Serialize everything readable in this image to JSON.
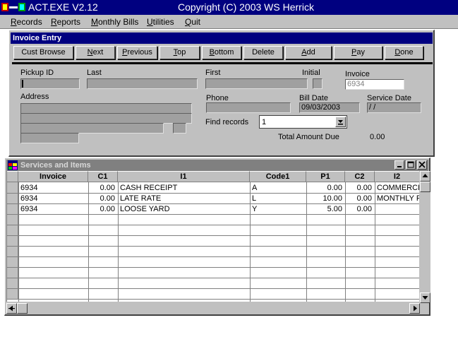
{
  "window": {
    "title": "ACT.EXE  V2.12",
    "copyright": "Copyright (C) 2003 WS Herrick"
  },
  "menu": [
    {
      "key": "R",
      "rest": "ecords"
    },
    {
      "key": "R",
      "rest": "eports"
    },
    {
      "key": "M",
      "rest": "onthly Bills"
    },
    {
      "key": "U",
      "rest": "tilities"
    },
    {
      "key": "Q",
      "rest": "uit"
    }
  ],
  "invoice_entry": {
    "header": "Invoice Entry",
    "buttons": {
      "cust_browse": "Cust Browse",
      "next": {
        "key": "N",
        "rest": "ext"
      },
      "previous": {
        "key": "P",
        "rest": "revious"
      },
      "top": {
        "key": "T",
        "rest": "op"
      },
      "bottom": {
        "key": "B",
        "rest": "ottom"
      },
      "delete": "Delete",
      "add": {
        "key": "A",
        "rest": "dd"
      },
      "pay": {
        "key": "P",
        "rest": "ay"
      },
      "done": {
        "key": "D",
        "rest": "one"
      }
    },
    "labels": {
      "pickup_id": "Pickup ID",
      "last": "Last",
      "first": "First",
      "initial": "Initial",
      "invoice": "Invoice",
      "address": "Address",
      "phone": "Phone",
      "bill_date": "Bill Date",
      "service_date": "Service Date",
      "find_records": "Find records",
      "total_amount_due": "Total Amount Due"
    },
    "values": {
      "invoice": "6934",
      "bill_date": "09/03/2003",
      "service_date": " / /",
      "find_records": "1",
      "total_amount_due": "0.00"
    }
  },
  "services": {
    "title": "Services and Items",
    "columns": [
      "Invoice",
      "C1",
      "I1",
      "Code1",
      "P1",
      "C2",
      "I2"
    ],
    "rows": [
      [
        "6934",
        "0.00",
        "CASH RECEIPT",
        "A",
        "0.00",
        "0.00",
        "COMMERCIAL"
      ],
      [
        "6934",
        "0.00",
        "LATE RATE",
        "L",
        "10.00",
        "0.00",
        "MONTHLY RATE"
      ],
      [
        "6934",
        "0.00",
        "LOOSE YARD",
        "Y",
        "5.00",
        "0.00",
        ""
      ]
    ]
  }
}
